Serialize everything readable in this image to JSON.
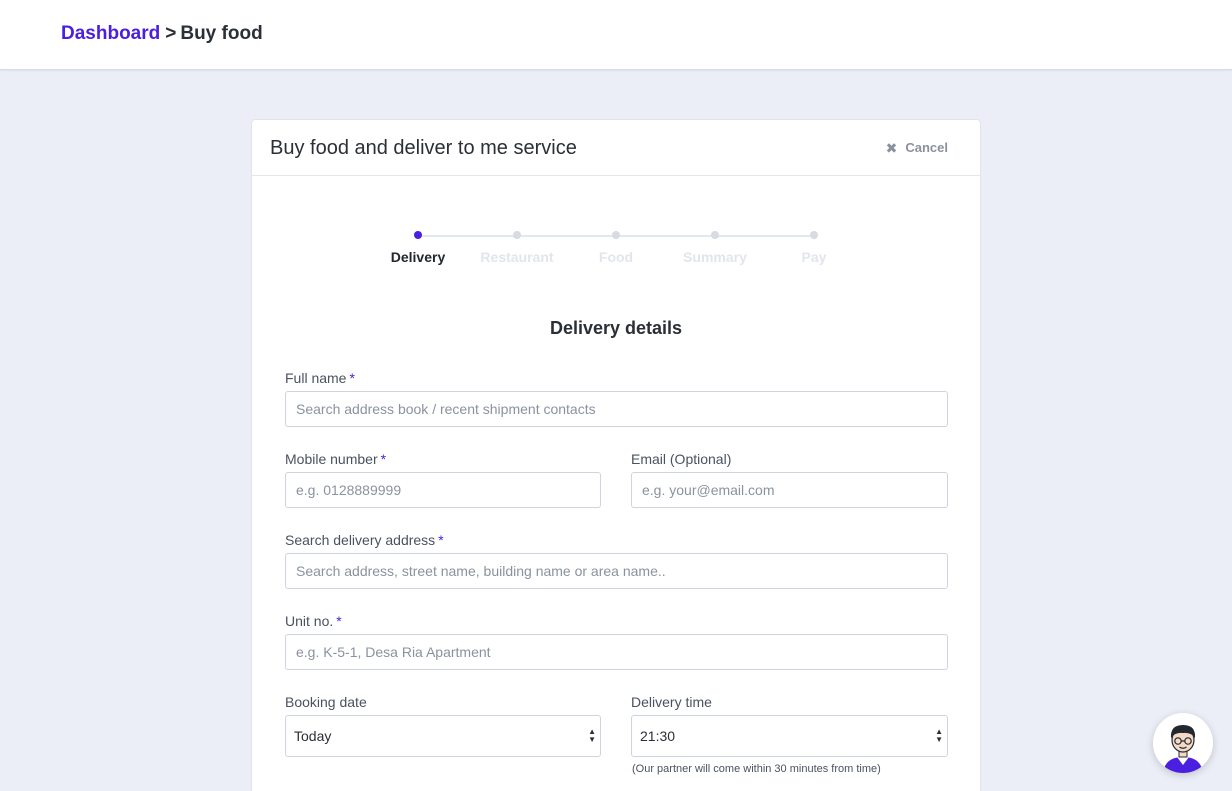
{
  "breadcrumb": {
    "root": "Dashboard",
    "separator": ">",
    "current": "Buy food"
  },
  "card": {
    "title": "Buy food and deliver to me service",
    "cancel_label": "Cancel",
    "cancel_icon": "close-icon"
  },
  "stepper": {
    "steps": [
      {
        "label": "Delivery",
        "active": true
      },
      {
        "label": "Restaurant",
        "active": false
      },
      {
        "label": "Food",
        "active": false
      },
      {
        "label": "Summary",
        "active": false
      },
      {
        "label": "Pay",
        "active": false
      }
    ]
  },
  "form": {
    "section_title": "Delivery details",
    "required_marker": "*",
    "full_name": {
      "label": "Full name",
      "placeholder": "Search address book / recent shipment contacts"
    },
    "mobile": {
      "label": "Mobile number",
      "placeholder": "e.g. 0128889999"
    },
    "email": {
      "label": "Email (Optional)",
      "placeholder": "e.g. your@email.com"
    },
    "address": {
      "label": "Search delivery address",
      "placeholder": "Search address, street name, building name or area name.."
    },
    "unit": {
      "label": "Unit no.",
      "placeholder": "e.g. K-5-1, Desa Ria Apartment"
    },
    "booking_date": {
      "label": "Booking date",
      "value": "Today"
    },
    "delivery_time": {
      "label": "Delivery time",
      "value": "21:30",
      "hint": "(Our partner will come within 30 minutes from time)"
    }
  },
  "colors": {
    "accent": "#4a1fe0",
    "background": "#ebeef6"
  }
}
